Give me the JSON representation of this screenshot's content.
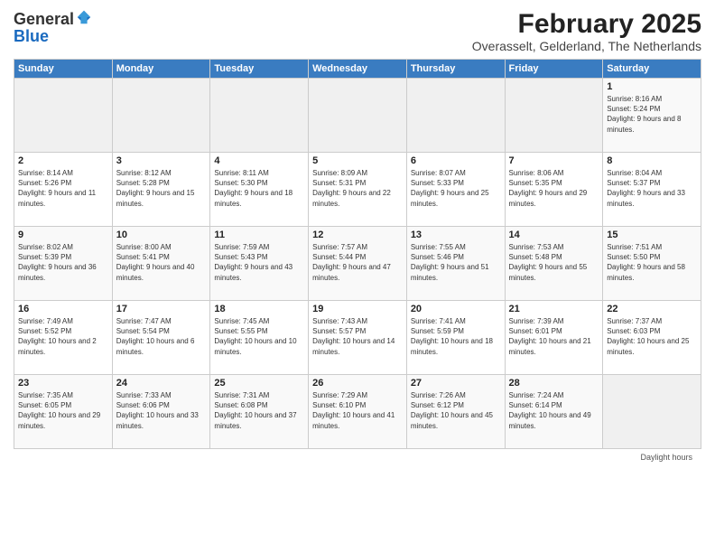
{
  "header": {
    "logo_general": "General",
    "logo_blue": "Blue",
    "month_title": "February 2025",
    "location": "Overasselt, Gelderland, The Netherlands"
  },
  "calendar": {
    "days_of_week": [
      "Sunday",
      "Monday",
      "Tuesday",
      "Wednesday",
      "Thursday",
      "Friday",
      "Saturday"
    ],
    "weeks": [
      [
        {
          "day": "",
          "info": ""
        },
        {
          "day": "",
          "info": ""
        },
        {
          "day": "",
          "info": ""
        },
        {
          "day": "",
          "info": ""
        },
        {
          "day": "",
          "info": ""
        },
        {
          "day": "",
          "info": ""
        },
        {
          "day": "1",
          "info": "Sunrise: 8:16 AM\nSunset: 5:24 PM\nDaylight: 9 hours and 8 minutes."
        }
      ],
      [
        {
          "day": "2",
          "info": "Sunrise: 8:14 AM\nSunset: 5:26 PM\nDaylight: 9 hours and 11 minutes."
        },
        {
          "day": "3",
          "info": "Sunrise: 8:12 AM\nSunset: 5:28 PM\nDaylight: 9 hours and 15 minutes."
        },
        {
          "day": "4",
          "info": "Sunrise: 8:11 AM\nSunset: 5:30 PM\nDaylight: 9 hours and 18 minutes."
        },
        {
          "day": "5",
          "info": "Sunrise: 8:09 AM\nSunset: 5:31 PM\nDaylight: 9 hours and 22 minutes."
        },
        {
          "day": "6",
          "info": "Sunrise: 8:07 AM\nSunset: 5:33 PM\nDaylight: 9 hours and 25 minutes."
        },
        {
          "day": "7",
          "info": "Sunrise: 8:06 AM\nSunset: 5:35 PM\nDaylight: 9 hours and 29 minutes."
        },
        {
          "day": "8",
          "info": "Sunrise: 8:04 AM\nSunset: 5:37 PM\nDaylight: 9 hours and 33 minutes."
        }
      ],
      [
        {
          "day": "9",
          "info": "Sunrise: 8:02 AM\nSunset: 5:39 PM\nDaylight: 9 hours and 36 minutes."
        },
        {
          "day": "10",
          "info": "Sunrise: 8:00 AM\nSunset: 5:41 PM\nDaylight: 9 hours and 40 minutes."
        },
        {
          "day": "11",
          "info": "Sunrise: 7:59 AM\nSunset: 5:43 PM\nDaylight: 9 hours and 43 minutes."
        },
        {
          "day": "12",
          "info": "Sunrise: 7:57 AM\nSunset: 5:44 PM\nDaylight: 9 hours and 47 minutes."
        },
        {
          "day": "13",
          "info": "Sunrise: 7:55 AM\nSunset: 5:46 PM\nDaylight: 9 hours and 51 minutes."
        },
        {
          "day": "14",
          "info": "Sunrise: 7:53 AM\nSunset: 5:48 PM\nDaylight: 9 hours and 55 minutes."
        },
        {
          "day": "15",
          "info": "Sunrise: 7:51 AM\nSunset: 5:50 PM\nDaylight: 9 hours and 58 minutes."
        }
      ],
      [
        {
          "day": "16",
          "info": "Sunrise: 7:49 AM\nSunset: 5:52 PM\nDaylight: 10 hours and 2 minutes."
        },
        {
          "day": "17",
          "info": "Sunrise: 7:47 AM\nSunset: 5:54 PM\nDaylight: 10 hours and 6 minutes."
        },
        {
          "day": "18",
          "info": "Sunrise: 7:45 AM\nSunset: 5:55 PM\nDaylight: 10 hours and 10 minutes."
        },
        {
          "day": "19",
          "info": "Sunrise: 7:43 AM\nSunset: 5:57 PM\nDaylight: 10 hours and 14 minutes."
        },
        {
          "day": "20",
          "info": "Sunrise: 7:41 AM\nSunset: 5:59 PM\nDaylight: 10 hours and 18 minutes."
        },
        {
          "day": "21",
          "info": "Sunrise: 7:39 AM\nSunset: 6:01 PM\nDaylight: 10 hours and 21 minutes."
        },
        {
          "day": "22",
          "info": "Sunrise: 7:37 AM\nSunset: 6:03 PM\nDaylight: 10 hours and 25 minutes."
        }
      ],
      [
        {
          "day": "23",
          "info": "Sunrise: 7:35 AM\nSunset: 6:05 PM\nDaylight: 10 hours and 29 minutes."
        },
        {
          "day": "24",
          "info": "Sunrise: 7:33 AM\nSunset: 6:06 PM\nDaylight: 10 hours and 33 minutes."
        },
        {
          "day": "25",
          "info": "Sunrise: 7:31 AM\nSunset: 6:08 PM\nDaylight: 10 hours and 37 minutes."
        },
        {
          "day": "26",
          "info": "Sunrise: 7:29 AM\nSunset: 6:10 PM\nDaylight: 10 hours and 41 minutes."
        },
        {
          "day": "27",
          "info": "Sunrise: 7:26 AM\nSunset: 6:12 PM\nDaylight: 10 hours and 45 minutes."
        },
        {
          "day": "28",
          "info": "Sunrise: 7:24 AM\nSunset: 6:14 PM\nDaylight: 10 hours and 49 minutes."
        },
        {
          "day": "",
          "info": ""
        }
      ]
    ]
  },
  "footer": {
    "label": "Daylight hours"
  }
}
